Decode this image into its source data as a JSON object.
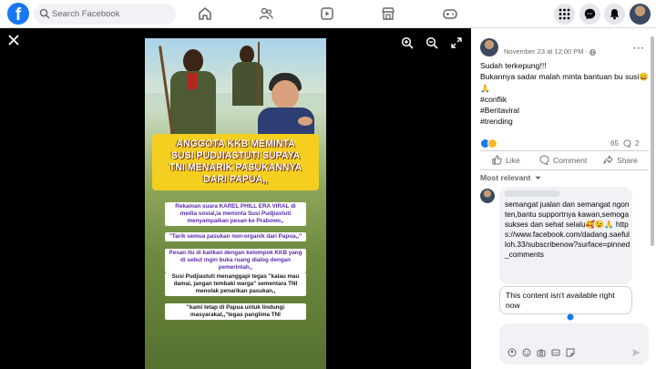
{
  "topbar": {
    "logo": "f",
    "search_placeholder": "Search Facebook",
    "nav_icons": [
      "home-icon",
      "friends-icon",
      "video-icon",
      "marketplace-icon",
      "gaming-icon"
    ],
    "right_icons": [
      "menu-grid-icon",
      "messenger-icon",
      "notifications-icon"
    ]
  },
  "viewer": {
    "banner_lines": [
      "ANGGOTA KKB MEMINTA",
      "SUSI PUDJIASTUTI SUPAYA",
      "TNI MENARIK PASUKANNYA",
      "DARI PAPUA,,"
    ],
    "caption_1": "Rekaman suara KAREL PHILL ERA VIRAL di media sosial,ia meminta Susi Pudjiastuti menyampaikan pesan ke Prabowo,,",
    "caption_2": "\"Tarik semua pasukan non-organik dari Papua,,\"",
    "caption_3": "Pesan itu di kaitkan dengan kelompok KKB yang di sebut ingin buka ruang dialog dengan pemerintah,,",
    "caption_4": "Susi Pudjiastuti menanggapi tegas \"kalau mau damai, jangan tembaki warga\" sementara TNI menolak penarikan pasukan,,",
    "caption_5": "\"kami tetap di Papua untuk lindungi masyarakat,,\"tegas panglima TNI"
  },
  "post": {
    "timestamp": "November 23 at 12:00 PM · ",
    "more": "···",
    "lines": [
      "Sudah terkepung!!!",
      "Bukannya sadar malah minta bantuan bu susi😄",
      "🙏",
      "#conflik",
      "#Beritaviral",
      "#trending"
    ],
    "reaction_count": "65",
    "comment_count": "2",
    "like_label": "Like",
    "comment_label": "Comment",
    "share_label": "Share",
    "sort_label": "Most relevant"
  },
  "comment": {
    "text": "semangat jualan dan semangat ngonten,bantu supportnya kawan,semoga sukses dan sehat selalu🥰😉🙏 https://www.facebook.com/dadang.saefulloh.33/subscribenow?surface=pinned_comments",
    "unavailable": "This content isn't available right now"
  },
  "composer": {
    "placeholder": ""
  },
  "colors": {
    "brand": "#1877f2",
    "banner": "#f4cf1f",
    "caption_purple": "#5b2aa8"
  }
}
